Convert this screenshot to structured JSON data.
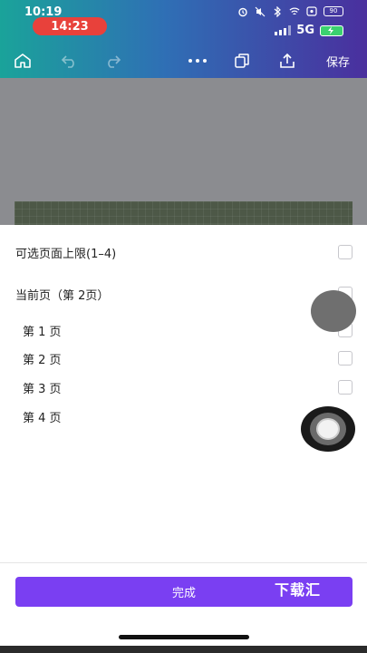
{
  "status_bar": {
    "time": "10:19",
    "call_pill": "14:23",
    "battery_top": "90",
    "network": "5G"
  },
  "toolbar": {
    "home_icon": "home-icon",
    "undo_icon": "undo-icon",
    "redo_icon": "redo-icon",
    "more_icon": "more-icon",
    "pages_icon": "pages-icon",
    "share_icon": "share-icon",
    "save_label": "保存"
  },
  "sheet": {
    "max_pages_label": "可选页面上限(1–4)",
    "current_page_label": "当前页（第 2页）",
    "pages": [
      {
        "label": "第 1 页"
      },
      {
        "label": "第 2 页"
      },
      {
        "label": "第 3 页"
      },
      {
        "label": "第 4 页"
      }
    ],
    "done_label": "完成",
    "watermark": "下载汇"
  },
  "colors": {
    "header_gradient_start": "#1aa39a",
    "header_gradient_end": "#4a2f9e",
    "accent": "#7a3ff2",
    "call_pill": "#e8413b",
    "canvas_gray": "#8b8c90"
  }
}
